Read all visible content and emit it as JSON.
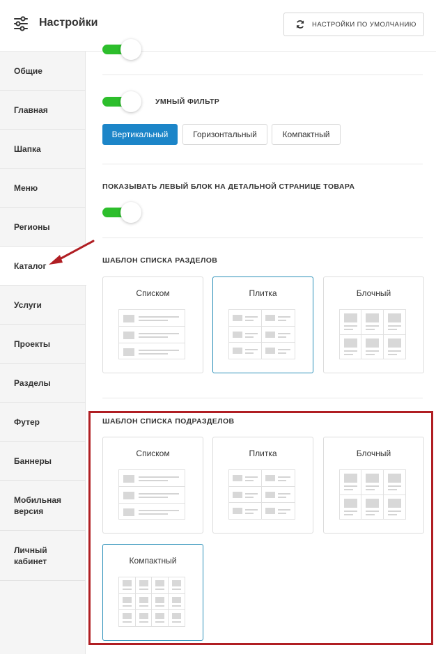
{
  "header": {
    "title": "Настройки",
    "reset_button": "НАСТРОЙКИ ПО УМОЛЧАНИЮ",
    "settings_icon": "sliders-icon",
    "reset_icon": "refresh-icon"
  },
  "sidebar": {
    "items": [
      {
        "label": "Общие"
      },
      {
        "label": "Главная"
      },
      {
        "label": "Шапка"
      },
      {
        "label": "Меню"
      },
      {
        "label": "Регионы"
      },
      {
        "label": "Каталог",
        "active": true
      },
      {
        "label": "Услуги"
      },
      {
        "label": "Проекты"
      },
      {
        "label": "Разделы"
      },
      {
        "label": "Футер"
      },
      {
        "label": "Баннеры"
      },
      {
        "label": "Мобильная версия"
      },
      {
        "label": "Личный кабинет"
      }
    ]
  },
  "smart_filter": {
    "label": "УМНЫЙ ФИЛЬТР",
    "enabled": true,
    "options": [
      "Вертикальный",
      "Горизонтальный",
      "Компактный"
    ],
    "selected": "Вертикальный"
  },
  "left_block": {
    "label": "ПОКАЗЫВАТЬ ЛЕВЫЙ БЛОК НА ДЕТАЛЬНОЙ СТРАНИЦЕ ТОВАРА",
    "enabled": true
  },
  "sections_template": {
    "label": "ШАБЛОН СПИСКА РАЗДЕЛОВ",
    "options": [
      "Списком",
      "Плитка",
      "Блочный"
    ],
    "selected": "Плитка"
  },
  "subsections_template": {
    "label": "ШАБЛОН СПИСКА ПОДРАЗДЕЛОВ",
    "options": [
      "Списком",
      "Плитка",
      "Блочный",
      "Компактный"
    ],
    "selected": "Компактный"
  },
  "colors": {
    "accent": "#1c85c8",
    "toggle_on": "#2dbe2c",
    "annotation": "#b01e23"
  }
}
